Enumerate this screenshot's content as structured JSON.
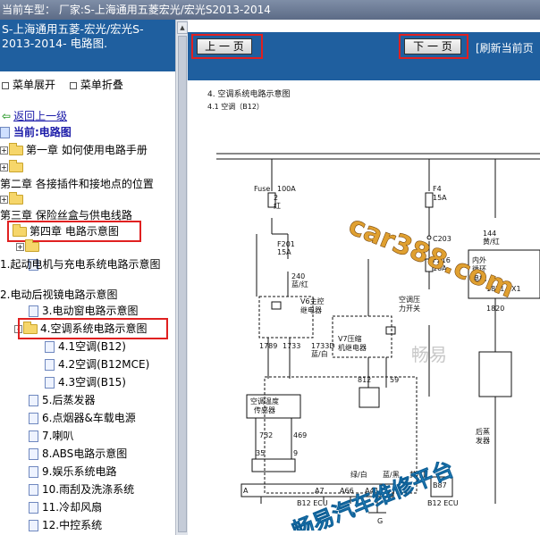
{
  "topbar": {
    "text": "当前车型：  厂家:S-上海通用五菱宏光/宏光S2013-2014"
  },
  "left": {
    "title": "S-上海通用五菱-宏光/宏光S-2013-2014- 电路图.",
    "menu": {
      "expand": "菜单展开",
      "collapse": "菜单折叠"
    },
    "back": "返回上一级",
    "current": "当前:电路图",
    "items": {
      "ch1": "第一章 如何使用电路手册",
      "ch2": "第二章 各接插件和接地点的位置",
      "ch3": "第三章 保险丝盒与供电线路",
      "ch4": "第四章 电路示意图",
      "s1": "1.起动电机与充电系统电路示意图",
      "s2": "2.电动后视镜电路示意图",
      "s3": "3.电动窗电路示意图",
      "s4": "4.空调系统电路示意图",
      "s41": "4.1空调(B12)",
      "s42": "4.2空调(B12MCE)",
      "s43": "4.3空调(B15)",
      "s5": "5.后蒸发器",
      "s6": "6.点烟器&车载电源",
      "s7": "7.喇叭",
      "s8": "8.ABS电路示意图",
      "s9": "9.娱乐系统电路",
      "s10": "10.雨刮及洗涤系统",
      "s11": "11.冷却风扇",
      "s12": "12.中控系统"
    }
  },
  "nav": {
    "prev": "上 一 页",
    "next": "下 一 页",
    "refresh": "[刷新当前页"
  },
  "diagram": {
    "section": "4.  空调系统电路示意图",
    "subsection": "4.1 空调（B12）",
    "fuse": "Fuse",
    "fuse_amp": "100A",
    "f201": "F201",
    "f201_amp": "15A",
    "f4": "F4",
    "f4_amp": "15A",
    "c203": "C203",
    "f216": "F216",
    "f216_amp": "10A",
    "w240": "240",
    "w240_color": "蓝/红",
    "w144": "144",
    "w144_color": "黄/红",
    "w2": "2",
    "w2_color": "红",
    "v6": "V6主控",
    "v6b": "继电器",
    "v7": "V7压缩",
    "v7b": "机继电器",
    "switch": "空调压",
    "switch_b": "力开关",
    "inner": "内外",
    "inner_b": "循环",
    "inner_c": "电机",
    "w1789": "1789",
    "w1733": "1733",
    "w1733b": "1733D",
    "w1733b_color": "蓝/白",
    "w812": "812",
    "w59": "59",
    "sensor": "空调温度",
    "sensor_b": "传感器",
    "w732": "732",
    "w469": "469",
    "w35": "35",
    "w9": "9",
    "w1821": "1821",
    "w1820": "1820",
    "x1": "X1",
    "rear": "后蒸",
    "rear_b": "发器",
    "ecu": "B12 ECU",
    "a": "A",
    "a7": "A7",
    "a66": "A66",
    "a41": "A41",
    "g": "G",
    "b87": "B87",
    "b12ecu2": "B12 ECU",
    "color_lv": "绿/白",
    "color_lh": "蓝/黑",
    "color_gh": "黄/红"
  },
  "watermark": {
    "url": "car388.com",
    "platform": "畅易汽车维修平台",
    "brand": "畅易"
  }
}
